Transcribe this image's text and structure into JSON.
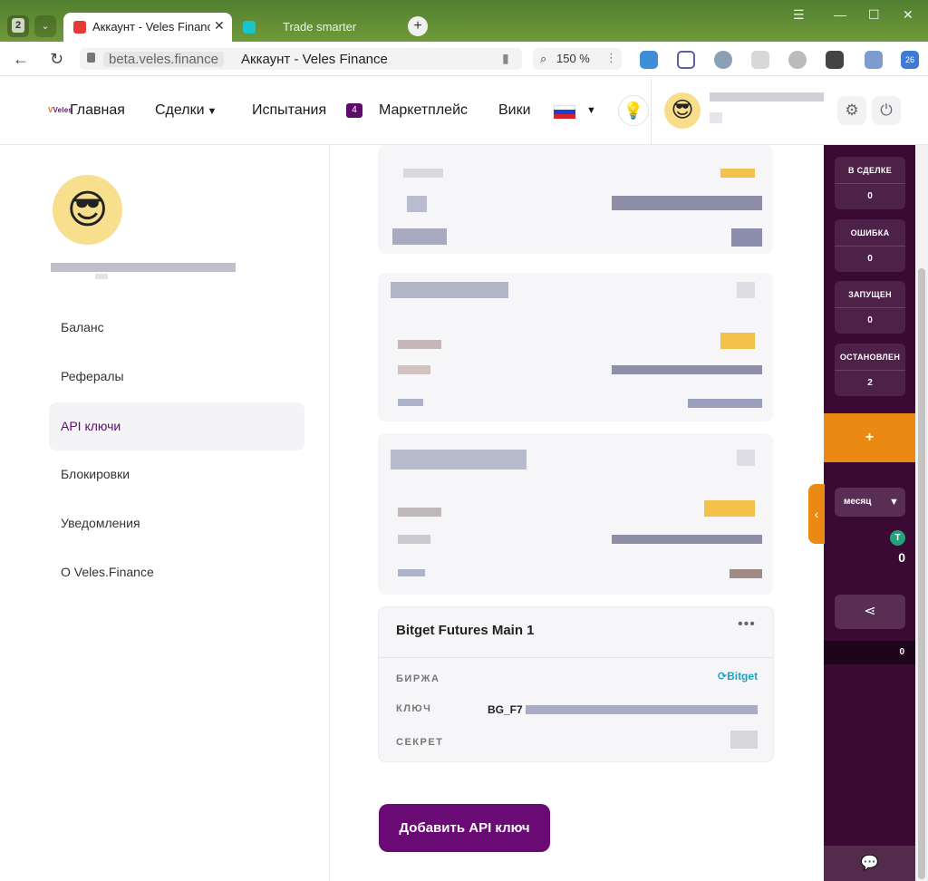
{
  "browser": {
    "tab_count": "2",
    "active_tab_title": "Аккаунт - Veles Finance",
    "second_tab_title": "Trade smarter",
    "url_host": "beta.veles.finance",
    "page_title": "Аккаунт - Veles Finance",
    "zoom": "150 %",
    "extension_badge": "26"
  },
  "header": {
    "logo": "Veles",
    "nav": {
      "home": "Главная",
      "deals": "Сделки",
      "tests": "Испытания",
      "tests_badge": "4",
      "marketplace": "Маркетплейс",
      "wiki": "Вики"
    }
  },
  "sidebar": {
    "items": [
      {
        "label": "Баланс"
      },
      {
        "label": "Рефералы"
      },
      {
        "label": "API ключи"
      },
      {
        "label": "Блокировки"
      },
      {
        "label": "Уведомления"
      },
      {
        "label": "О Veles.Finance"
      }
    ]
  },
  "api_key_card": {
    "title": "Bitget Futures Main 1",
    "exchange_label": "БИРЖА",
    "exchange_value": "Bitget",
    "key_label": "КЛЮЧ",
    "key_value": "BG_F7",
    "secret_label": "СЕКРЕТ"
  },
  "add_button": "Добавить API ключ",
  "right_panel": {
    "stats": [
      {
        "label": "В СДЕЛКЕ",
        "value": "0"
      },
      {
        "label": "ОШИБКА",
        "value": "0"
      },
      {
        "label": "ЗАПУЩЕН",
        "value": "0"
      },
      {
        "label": "ОСТАНОВЛЕН",
        "value": "2"
      }
    ],
    "plus": "+",
    "period": "месяц",
    "profit": "0",
    "bottom_value": "0"
  },
  "colors": {
    "brand_purple": "#6a0a74",
    "sidebar_dark": "#3a0a35",
    "accent_orange": "#ea8a12"
  }
}
